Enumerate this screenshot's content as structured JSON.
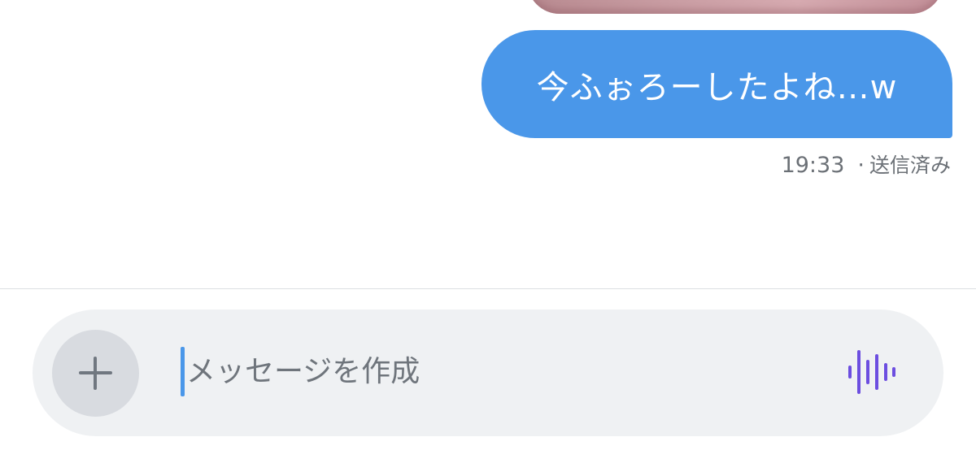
{
  "conversation": {
    "messages": [
      {
        "text": "今ふぉろーしたよね…w",
        "time": "19:33",
        "separator": "·",
        "status": "送信済み",
        "bubble_color": "#4a97e9"
      }
    ]
  },
  "composer": {
    "placeholder": "メッセージを作成",
    "value": "",
    "add_icon": "plus-icon",
    "voice_icon": "voice-waveform-icon",
    "voice_icon_color": "#6c4ee0"
  }
}
